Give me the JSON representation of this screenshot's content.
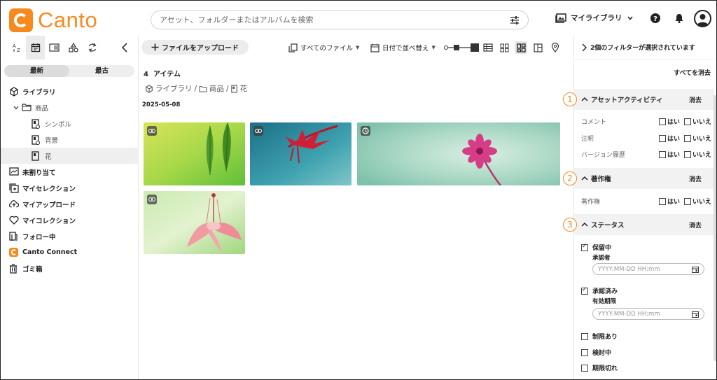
{
  "brand": {
    "name": "Canto",
    "color": "#f68a1f"
  },
  "search": {
    "placeholder": "アセット、フォルダーまたはアルバムを検索"
  },
  "header": {
    "library_switch": "マイライブラリ"
  },
  "sidebar": {
    "segments": [
      "最新",
      "最古"
    ],
    "tree": [
      {
        "label": "ライブラリ",
        "icon": "library-icon"
      },
      {
        "label": "商品",
        "icon": "folder-icon"
      },
      {
        "label": "シンボル",
        "icon": "album-icon"
      },
      {
        "label": "背景",
        "icon": "album-icon"
      },
      {
        "label": "花",
        "icon": "album-icon"
      },
      {
        "label": "未割り当て",
        "icon": "unassigned-icon"
      },
      {
        "label": "マイセレクション",
        "icon": "selection-icon"
      },
      {
        "label": "マイアップロード",
        "icon": "cloud-upload-icon"
      },
      {
        "label": "マイコレクション",
        "icon": "heart-icon"
      },
      {
        "label": "フォロー中",
        "icon": "follow-icon"
      },
      {
        "label": "Canto Connect",
        "icon": "canto-connect-icon"
      },
      {
        "label": "ゴミ箱",
        "icon": "trash-icon"
      }
    ]
  },
  "toolbar": {
    "upload_label": "ファイルをアップロード",
    "file_filter": "すべてのファイル",
    "sort": "日付で並べ替え"
  },
  "main": {
    "count_number": "4",
    "count_unit": "アイテム",
    "breadcrumb": [
      "ライブラリ",
      "商品",
      "花"
    ],
    "date_group": "2025-05-08"
  },
  "panel": {
    "selected_filters": "2個のフィルターが選択されています",
    "clear_all": "すべてを消去",
    "clear": "消去",
    "yes": "はい",
    "no": "いいえ",
    "sections": [
      {
        "num": "1",
        "title": "アセットアクティビティ",
        "rows": [
          "コメント",
          "注釈",
          "バージョン履歴"
        ]
      },
      {
        "num": "2",
        "title": "著作権",
        "rows": [
          "著作権"
        ]
      },
      {
        "num": "3",
        "title": "ステータス"
      }
    ],
    "status": {
      "pending": "保留中",
      "approver": "承認者",
      "approved": "承認済み",
      "expiry": "有効期限",
      "date_placeholder": "YYYY-MM-DD HH:mm",
      "restricted": "制限あり",
      "review": "検討中",
      "expired": "期限切れ"
    }
  }
}
